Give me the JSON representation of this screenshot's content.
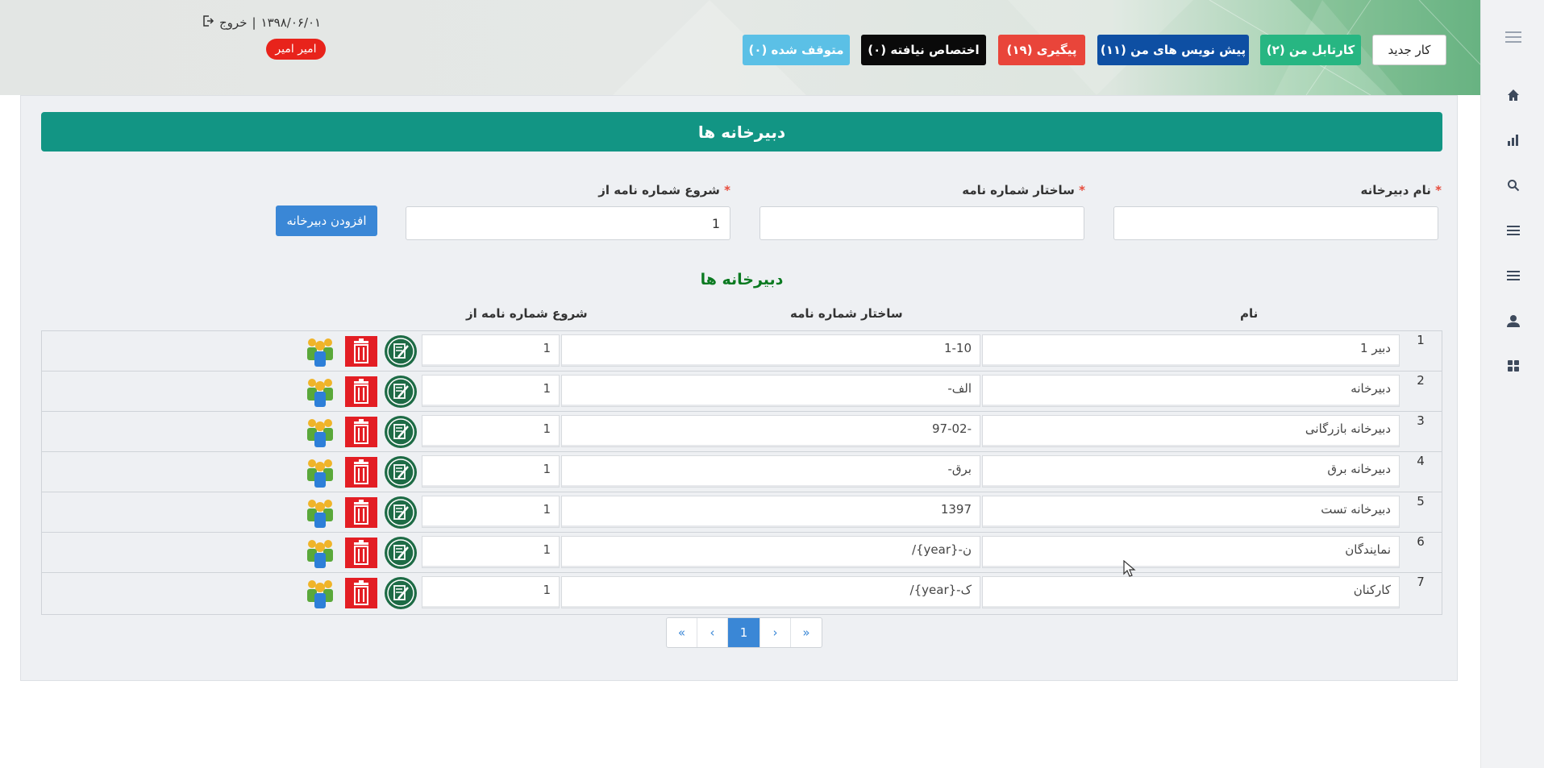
{
  "header": {
    "buttons": {
      "new_task": "کار جدید",
      "my_kartabl": "کارتابل من (۲)",
      "my_drafts": "پیش نویس های من (۱۱)",
      "follow_up": "پیگیری (۱۹)",
      "unassigned": "اختصاص نیافته (۰)",
      "stopped": "متوقف شده (۰)"
    },
    "date": "۱۳۹۸/۰۶/۰۱",
    "logout_label": "خروج",
    "separator": "|",
    "user_name": "امیر امیر"
  },
  "sidebar": {
    "icons": [
      "menu-icon",
      "home-icon",
      "chart-icon",
      "search-icon",
      "list-icon",
      "list-icon",
      "user-icon",
      "grid-icon"
    ]
  },
  "page": {
    "title": "دبیرخانه ها"
  },
  "form": {
    "name_label": "نام دبیرخانه",
    "structure_label": "ساختار شماره نامه",
    "start_label": "شروع شماره نامه از",
    "required_mark": "*",
    "name_value": "",
    "structure_value": "",
    "start_value": "1",
    "add_button": "افزودن دبیرخانه"
  },
  "list": {
    "title": "دبیرخانه ها",
    "columns": {
      "name": "نام",
      "structure": "ساختار شماره نامه",
      "start": "شروع شماره نامه از"
    },
    "rows": [
      {
        "num": "1",
        "name": "دبیر 1",
        "structure": "1-10",
        "start": "1"
      },
      {
        "num": "2",
        "name": "دبیرخانه",
        "structure": "الف-",
        "start": "1"
      },
      {
        "num": "3",
        "name": "دبیرخانه بازرگانی",
        "structure": "-97-02",
        "start": "1"
      },
      {
        "num": "4",
        "name": "دبیرخانه برق",
        "structure": "برق-",
        "start": "1"
      },
      {
        "num": "5",
        "name": "دبیرخانه تست",
        "structure": "1397",
        "start": "1"
      },
      {
        "num": "6",
        "name": "نمایندگان",
        "structure": "ن-{year}/",
        "start": "1"
      },
      {
        "num": "7",
        "name": "کارکنان",
        "structure": "ک-{year}/",
        "start": "1"
      }
    ]
  },
  "pagination": {
    "first": "«",
    "prev": "‹",
    "current": "1",
    "next": "›",
    "last": "»"
  },
  "colors": {
    "title_bar": "#129584",
    "primary": "#3a87d6",
    "list_title": "#0b7a21"
  }
}
